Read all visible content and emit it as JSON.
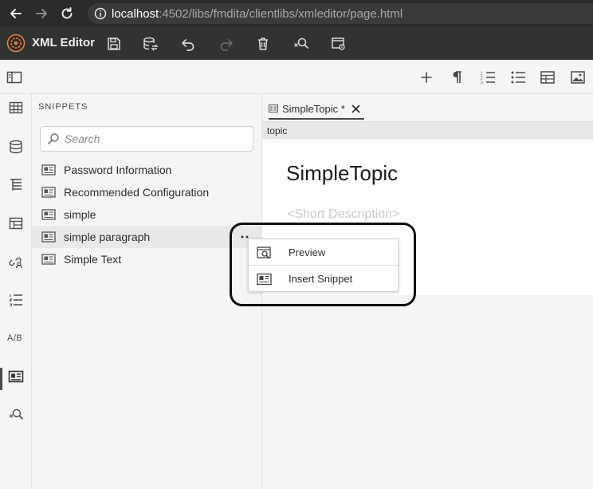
{
  "browser": {
    "url_host": "localhost",
    "url_rest": ":4502/libs/fmdita/clientlibs/xmleditor/page.html"
  },
  "app": {
    "title": "XML Editor"
  },
  "panel": {
    "title": "SNIPPETS",
    "search_placeholder": "Search",
    "items": [
      {
        "label": "Password Information"
      },
      {
        "label": "Recommended Configuration"
      },
      {
        "label": "simple"
      },
      {
        "label": "simple paragraph"
      },
      {
        "label": "Simple Text"
      }
    ],
    "selected_index": 3
  },
  "rail": {
    "ab_label": "A/B"
  },
  "editor": {
    "tab_label": "SimpleTopic *",
    "breadcrumb": "topic",
    "doc_title": "SimpleTopic",
    "short_desc": "<Short Description>"
  },
  "context_menu": {
    "items": [
      {
        "label": "Preview",
        "icon": "preview-icon"
      },
      {
        "label": "Insert Snippet",
        "icon": "snippet-icon"
      }
    ]
  },
  "colors": {
    "browser_bg": "#2b2b2b",
    "app_bar_bg": "#323232",
    "panel_bg": "#f5f5f5",
    "highlight": "#111111"
  }
}
